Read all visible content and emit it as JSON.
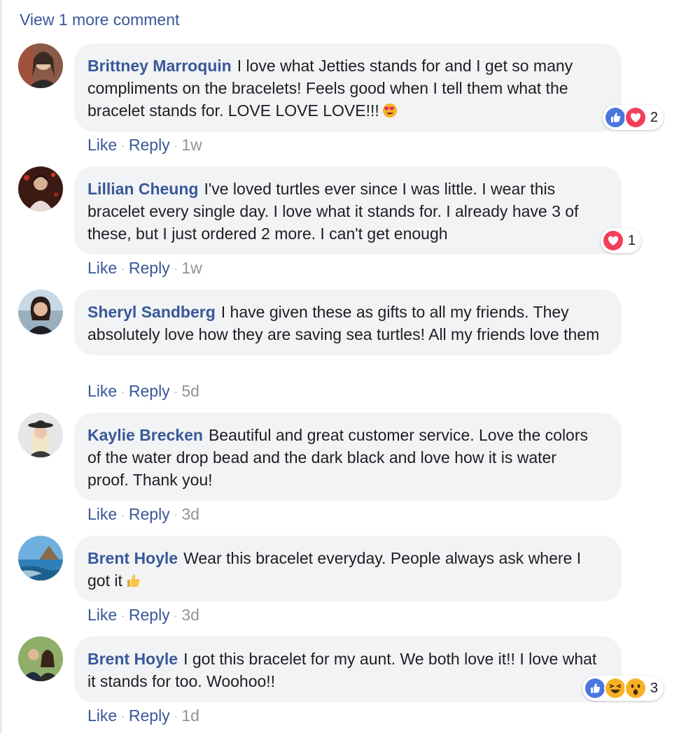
{
  "view_more_label": "View 1 more comment",
  "colors": {
    "link": "#385898",
    "bubble": "#f2f3f5",
    "meta": "#90949c",
    "like_blue": "#1877f2",
    "love_red": "#f33e58",
    "haha_yellow": "#f7b125"
  },
  "action_labels": {
    "like": "Like",
    "reply": "Reply",
    "separator": "·"
  },
  "comments": [
    {
      "author": "Brittney Marroquin",
      "text": "I love what Jetties stands for and I get so many compliments on the bracelets! Feels good when I tell them what the bracelet stands for. LOVE LOVE LOVE!!!",
      "emoji": "heart-eyes-emoji",
      "time": "1w",
      "reactions": [
        "like-icon",
        "love-icon"
      ],
      "reaction_count": "2"
    },
    {
      "author": "Lillian Cheung",
      "text": "I've loved turtles ever since I was little. I wear this bracelet every single day. I love what it stands for. I already have 3 of these, but I just ordered 2 more. I can't get enough",
      "time": "1w",
      "reactions": [
        "love-icon"
      ],
      "reaction_count": "1"
    },
    {
      "author": "Sheryl Sandberg",
      "text": "I have given these as gifts to all my friends. They absolutely love how they are saving sea turtles! All my friends love them",
      "time": "5d"
    },
    {
      "author": "Kaylie Brecken",
      "text": "Beautiful and great customer service. Love the colors of the water drop bead and the dark black and love how it is water proof. Thank you!",
      "time": "3d"
    },
    {
      "author": "Brent Hoyle",
      "text": "Wear this bracelet everyday. People always ask where I got it",
      "emoji": "thumbs-up-emoji",
      "time": "3d"
    },
    {
      "author": "Brent Hoyle",
      "text": "I got this bracelet for my aunt. We both love it!! I love what it stands for too. Woohoo!!",
      "time": "1d",
      "reactions": [
        "like-icon",
        "haha-icon",
        "wow-icon"
      ],
      "reaction_count": "3"
    }
  ]
}
